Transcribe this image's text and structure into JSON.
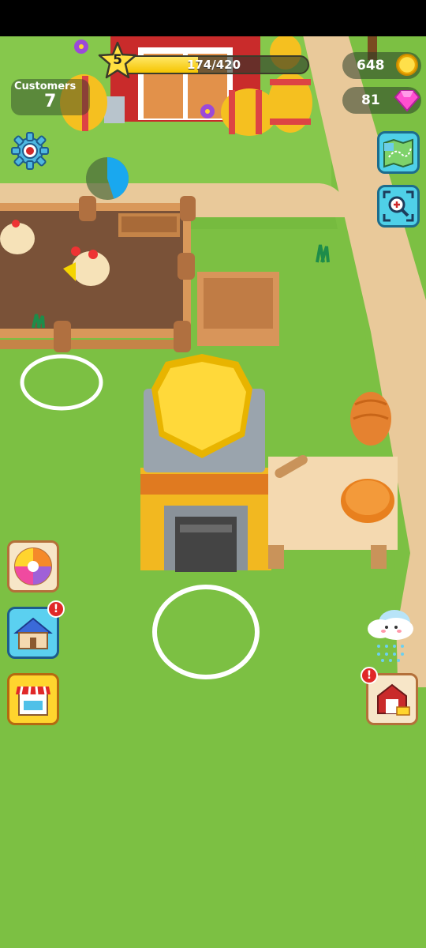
{
  "hud": {
    "level": "5",
    "xp_text": "174/420",
    "xp_progress": 0.414,
    "customers_label": "Customers",
    "customers_count": "7",
    "coins": "648",
    "gems": "81",
    "timer_progress": 0.45
  },
  "buttons": {
    "home_alert": "!",
    "storage_alert": "!"
  },
  "colors": {
    "grass": "#7cc043",
    "path": "#e9c99a",
    "accent_blue": "#4fd0e8",
    "alert_red": "#e02828",
    "coin_gold": "#ffd52e"
  },
  "icons": {
    "settings": "gear-icon",
    "map": "map-icon",
    "zoom": "zoom-scan-icon",
    "spin": "spin-wheel-icon",
    "home": "house-icon",
    "shop": "shop-icon",
    "storage": "barn-chest-icon",
    "weather": "rain-cloud-icon"
  }
}
